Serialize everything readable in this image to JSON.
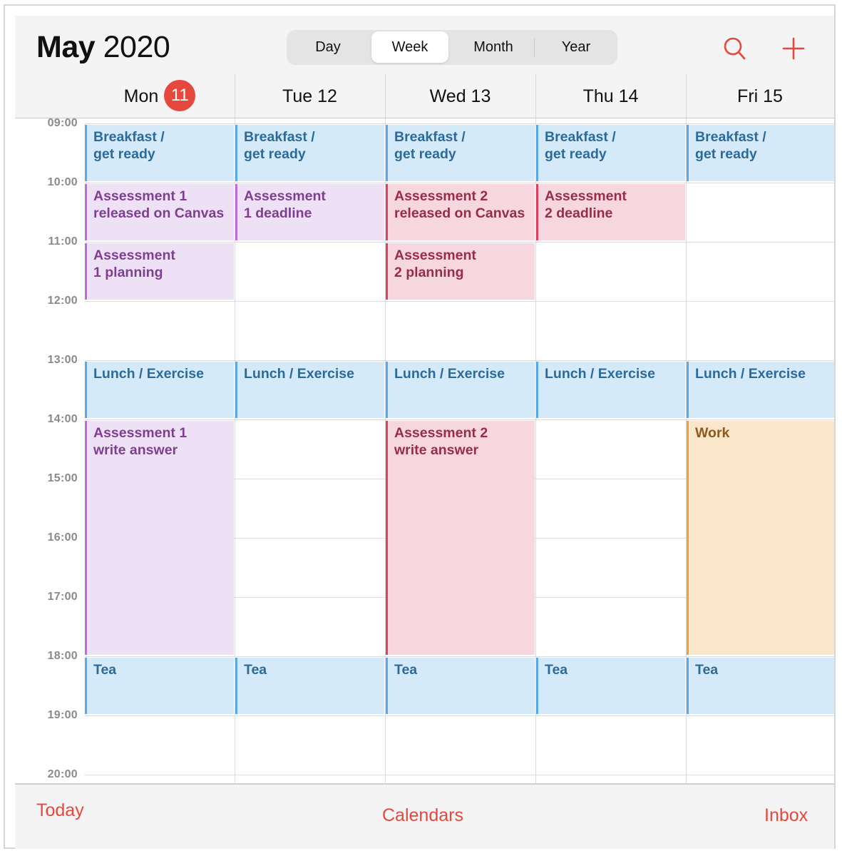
{
  "header": {
    "month": "May",
    "year": "2020",
    "view_tabs": [
      {
        "label": "Day",
        "active": false
      },
      {
        "label": "Week",
        "active": true
      },
      {
        "label": "Month",
        "active": false
      },
      {
        "label": "Year",
        "active": false
      }
    ],
    "search_icon": "search-icon",
    "add_icon": "plus-icon",
    "accent_color": "#e5483c"
  },
  "days": [
    {
      "name": "Mon",
      "date": "11",
      "today": true
    },
    {
      "name": "Tue",
      "date": "12",
      "today": false
    },
    {
      "name": "Wed",
      "date": "13",
      "today": false
    },
    {
      "name": "Thu",
      "date": "14",
      "today": false
    },
    {
      "name": "Fri",
      "date": "15",
      "today": false
    }
  ],
  "day_labels": [
    "Mon",
    "Tue 12",
    "Wed 13",
    "Thu 14",
    "Fri 15"
  ],
  "today_badge": "11",
  "hours": [
    "09:00",
    "10:00",
    "11:00",
    "12:00",
    "13:00",
    "14:00",
    "15:00",
    "16:00",
    "17:00",
    "18:00",
    "19:00",
    "20:00"
  ],
  "calendars": {
    "blue": {
      "fill": "#d5eaf8",
      "bar": "#58a8ee",
      "text": "#2c6a99"
    },
    "purple": {
      "fill": "#efe1f5",
      "bar": "#bd6be0",
      "text": "#7d3f8f"
    },
    "pink": {
      "fill": "#f6d6df",
      "bar": "#e0405f",
      "text": "#972d47"
    },
    "orange": {
      "fill": "#fae7cb",
      "bar": "#f2a03c",
      "text": "#8d5a1e"
    }
  },
  "events": [
    {
      "day": 0,
      "start": 9,
      "end": 10,
      "cal": "blue",
      "lines": [
        "Breakfast /",
        "get ready"
      ]
    },
    {
      "day": 1,
      "start": 9,
      "end": 10,
      "cal": "blue",
      "lines": [
        "Breakfast /",
        "get ready"
      ]
    },
    {
      "day": 2,
      "start": 9,
      "end": 10,
      "cal": "blue",
      "lines": [
        "Breakfast /",
        "get ready"
      ]
    },
    {
      "day": 3,
      "start": 9,
      "end": 10,
      "cal": "blue",
      "lines": [
        "Breakfast /",
        "get ready"
      ]
    },
    {
      "day": 4,
      "start": 9,
      "end": 10,
      "cal": "blue",
      "lines": [
        "Breakfast /",
        "get ready"
      ]
    },
    {
      "day": 0,
      "start": 10,
      "end": 11,
      "cal": "purple",
      "lines": [
        "Assessment 1",
        "released on Canvas"
      ]
    },
    {
      "day": 1,
      "start": 10,
      "end": 11,
      "cal": "purple",
      "lines": [
        "Assessment",
        "1 deadline"
      ]
    },
    {
      "day": 2,
      "start": 10,
      "end": 11,
      "cal": "pink",
      "lines": [
        "Assessment 2",
        "released on Canvas"
      ]
    },
    {
      "day": 3,
      "start": 10,
      "end": 11,
      "cal": "pink",
      "lines": [
        "Assessment",
        "2 deadline"
      ]
    },
    {
      "day": 0,
      "start": 11,
      "end": 12,
      "cal": "purple",
      "lines": [
        "Assessment",
        "1 planning"
      ]
    },
    {
      "day": 2,
      "start": 11,
      "end": 12,
      "cal": "pink",
      "lines": [
        "Assessment",
        "2 planning"
      ]
    },
    {
      "day": 0,
      "start": 13,
      "end": 14,
      "cal": "blue",
      "lines": [
        "Lunch / Exercise"
      ]
    },
    {
      "day": 1,
      "start": 13,
      "end": 14,
      "cal": "blue",
      "lines": [
        "Lunch / Exercise"
      ]
    },
    {
      "day": 2,
      "start": 13,
      "end": 14,
      "cal": "blue",
      "lines": [
        "Lunch / Exercise"
      ]
    },
    {
      "day": 3,
      "start": 13,
      "end": 14,
      "cal": "blue",
      "lines": [
        "Lunch / Exercise"
      ]
    },
    {
      "day": 4,
      "start": 13,
      "end": 14,
      "cal": "blue",
      "lines": [
        "Lunch / Exercise"
      ]
    },
    {
      "day": 0,
      "start": 14,
      "end": 18,
      "cal": "purple",
      "lines": [
        "Assessment 1",
        "write answer"
      ]
    },
    {
      "day": 2,
      "start": 14,
      "end": 18,
      "cal": "pink",
      "lines": [
        "Assessment 2",
        "write answer"
      ]
    },
    {
      "day": 4,
      "start": 14,
      "end": 18,
      "cal": "orange",
      "lines": [
        "Work"
      ]
    },
    {
      "day": 0,
      "start": 18,
      "end": 19,
      "cal": "blue",
      "lines": [
        "Tea"
      ]
    },
    {
      "day": 1,
      "start": 18,
      "end": 19,
      "cal": "blue",
      "lines": [
        "Tea"
      ]
    },
    {
      "day": 2,
      "start": 18,
      "end": 19,
      "cal": "blue",
      "lines": [
        "Tea"
      ]
    },
    {
      "day": 3,
      "start": 18,
      "end": 19,
      "cal": "blue",
      "lines": [
        "Tea"
      ]
    },
    {
      "day": 4,
      "start": 18,
      "end": 19,
      "cal": "blue",
      "lines": [
        "Tea"
      ]
    }
  ],
  "footer": {
    "today": "Today",
    "calendars": "Calendars",
    "inbox": "Inbox"
  }
}
